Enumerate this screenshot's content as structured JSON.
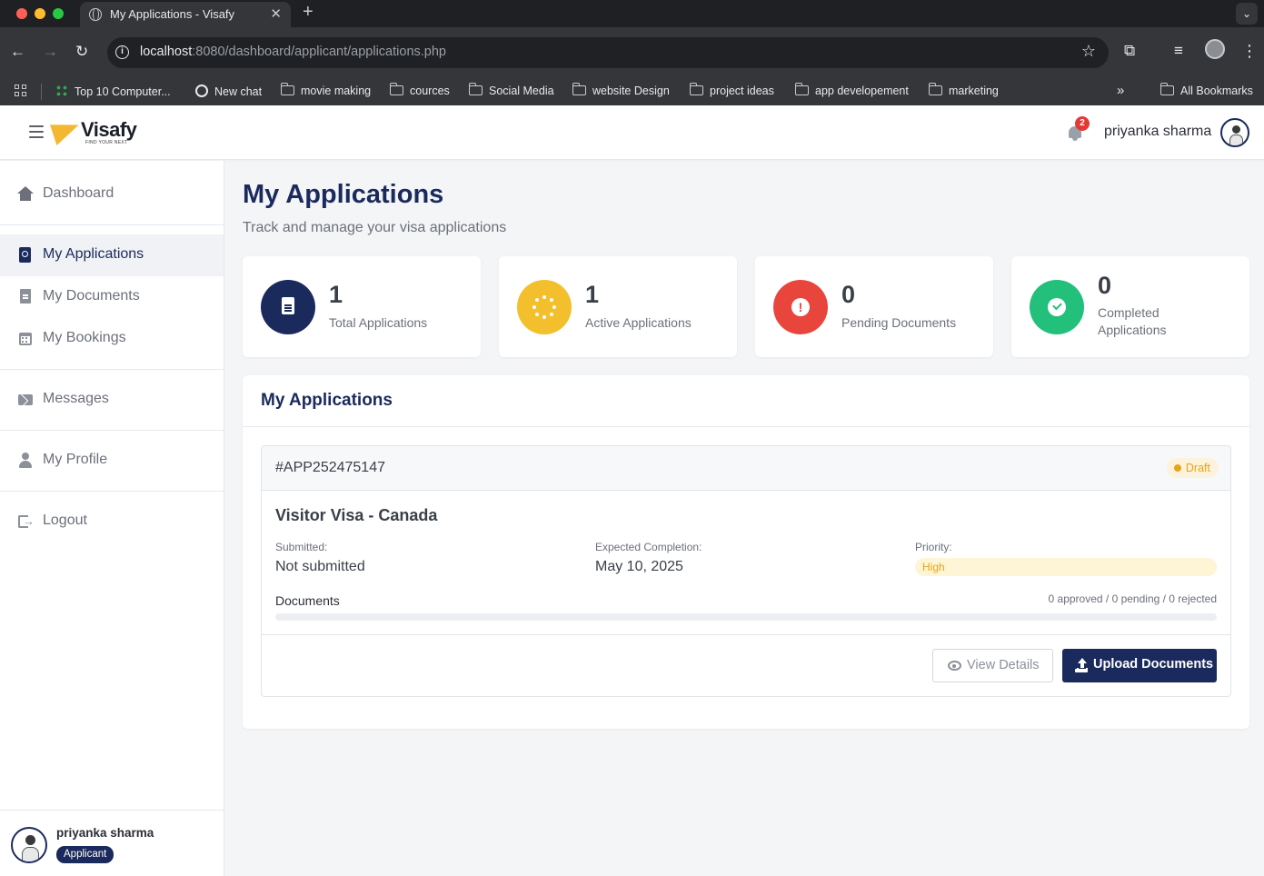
{
  "browser": {
    "tab_title": "My Applications - Visafy",
    "url_host": "localhost",
    "url_rest": ":8080/dashboard/applicant/applications.php",
    "bookmarks": [
      "Top 10 Computer...",
      "New chat",
      "movie making",
      "cources",
      "Social Media",
      "website Design",
      "project ideas",
      "app developement",
      "marketing"
    ],
    "all_bookmarks": "All Bookmarks"
  },
  "header": {
    "logo_text": "Visafy",
    "logo_tagline": "FIND YOUR NEXT",
    "notification_count": "2",
    "user_name": "priyanka sharma"
  },
  "sidebar": {
    "items": [
      {
        "label": "Dashboard",
        "icon": "home-icon"
      },
      {
        "label": "My Applications",
        "icon": "passport-icon",
        "active": true
      },
      {
        "label": "My Documents",
        "icon": "document-icon"
      },
      {
        "label": "My Bookings",
        "icon": "calendar-icon"
      },
      {
        "label": "Messages",
        "icon": "envelope-icon"
      },
      {
        "label": "My Profile",
        "icon": "user-icon"
      },
      {
        "label": "Logout",
        "icon": "logout-icon"
      }
    ],
    "footer": {
      "user_name": "priyanka sharma",
      "role": "Applicant"
    }
  },
  "page": {
    "title": "My Applications",
    "subtitle": "Track and manage your visa applications"
  },
  "stats": [
    {
      "value": "1",
      "label": "Total Applications",
      "color": "#1b2a5c",
      "icon": "file-icon"
    },
    {
      "value": "1",
      "label": "Active Applications",
      "color": "#f4bf2c",
      "icon": "spinner-icon"
    },
    {
      "value": "0",
      "label": "Pending Documents",
      "color": "#e8453c",
      "icon": "exclamation-icon"
    },
    {
      "value": "0",
      "label": "Completed Applications",
      "color": "#22c07a",
      "icon": "check-icon"
    }
  ],
  "applications_panel": {
    "title": "My Applications",
    "applications": [
      {
        "id": "#APP252475147",
        "status": "Draft",
        "visa_title": "Visitor Visa - Canada",
        "submitted_label": "Submitted:",
        "submitted_value": "Not submitted",
        "expected_label": "Expected Completion:",
        "expected_value": "May 10, 2025",
        "priority_label": "Priority:",
        "priority_value": "High",
        "documents_label": "Documents",
        "documents_summary": "0 approved / 0 pending / 0 rejected",
        "documents_progress": 0,
        "view_button": "View Details",
        "upload_button": "Upload Documents"
      }
    ]
  }
}
